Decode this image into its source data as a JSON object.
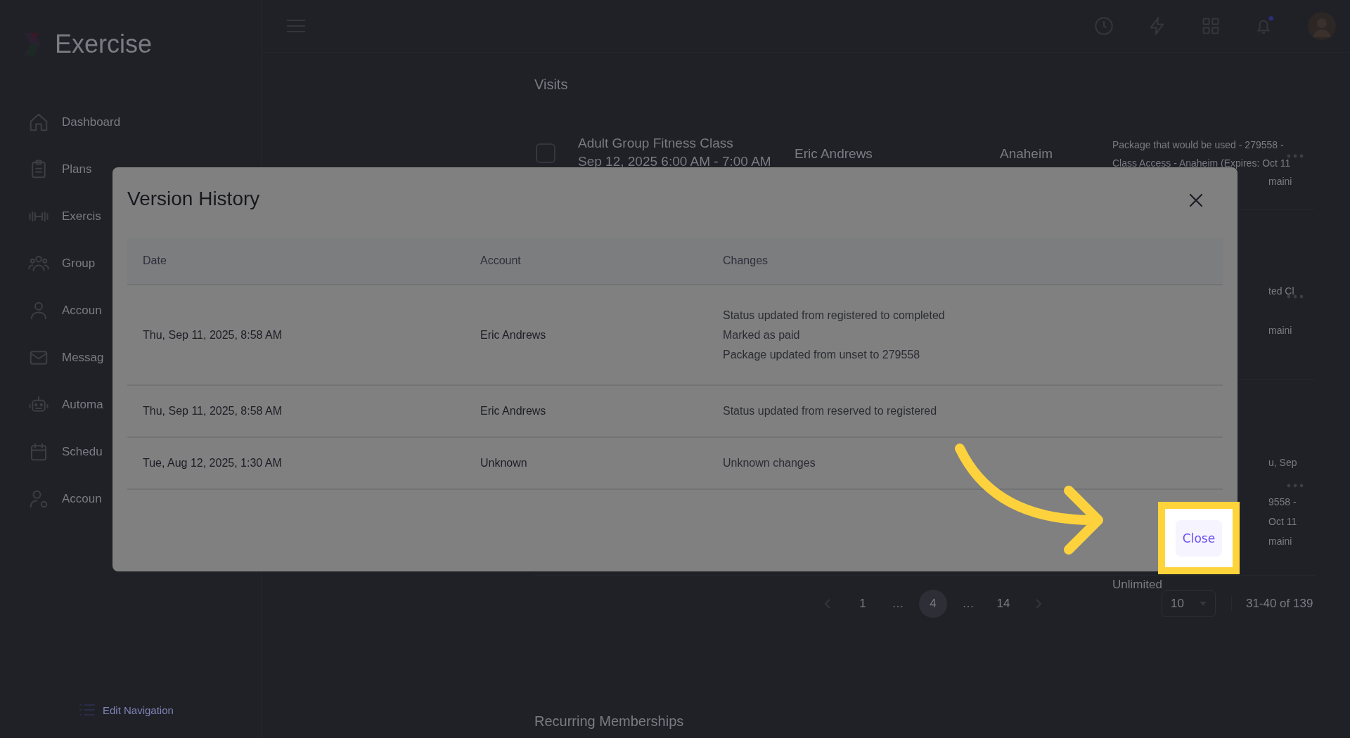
{
  "app": {
    "name": "Exercise"
  },
  "sidebar": {
    "items": [
      {
        "label": "Dashboard",
        "kind": "home"
      },
      {
        "label": "Plans",
        "kind": "clipboard"
      },
      {
        "label": "Exercis",
        "kind": "dumbbell"
      },
      {
        "label": "Group",
        "kind": "people"
      },
      {
        "label": "Accoun",
        "kind": "person"
      },
      {
        "label": "Messag",
        "kind": "mail"
      },
      {
        "label": "Automa",
        "kind": "robot"
      },
      {
        "label": "Schedu",
        "kind": "calendar"
      },
      {
        "label": "Accoun",
        "kind": "person-gear"
      }
    ],
    "edit_navigation": "Edit Navigation"
  },
  "topbar": {
    "notification_unread": true
  },
  "visits": {
    "title": "Visits",
    "rows": [
      {
        "checked": false,
        "class": "Adult Group Fitness Class",
        "time": "Sep 12, 2025 6:00 AM - 7:00 AM",
        "account": "Eric Andrews",
        "location": "Anaheim",
        "package_lines": [
          "Package that would be used - 279558 -",
          "Class Access - Anaheim (Expires: Oct 11"
        ],
        "covered_fragments": [
          "maini"
        ]
      },
      {
        "package_lines": [],
        "covered_fragments": [
          "ted Cl",
          "maini"
        ]
      },
      {
        "package_lines": [],
        "covered_fragments": [
          "u, Sep",
          "9558 -",
          "Oct 11",
          "maini"
        ],
        "footer": "Unlimited"
      }
    ]
  },
  "pagination": {
    "pages": [
      {
        "label": "1",
        "selected": false
      },
      {
        "label": "…",
        "selected": false
      },
      {
        "label": "4",
        "selected": true
      },
      {
        "label": "…",
        "selected": false
      },
      {
        "label": "14",
        "selected": false
      }
    ],
    "per_page": "10",
    "range": "31-40 of 139"
  },
  "recurring": {
    "title": "Recurring Memberships"
  },
  "modal": {
    "title": "Version History",
    "columns": [
      "Date",
      "Account",
      "Changes"
    ],
    "rows": [
      {
        "date": "Thu, Sep 11, 2025, 8:58 AM",
        "account": "Eric Andrews",
        "changes": [
          "Status updated from registered to completed",
          "Marked as paid",
          "Package updated from unset to 279558"
        ]
      },
      {
        "date": "Thu, Sep 11, 2025, 8:58 AM",
        "account": "Eric Andrews",
        "changes": [
          "Status updated from reserved to registered"
        ]
      },
      {
        "date": "Tue, Aug 12, 2025, 1:30 AM",
        "account": "Unknown",
        "changes": [
          "Unknown changes"
        ]
      }
    ],
    "close_button": "Close"
  }
}
